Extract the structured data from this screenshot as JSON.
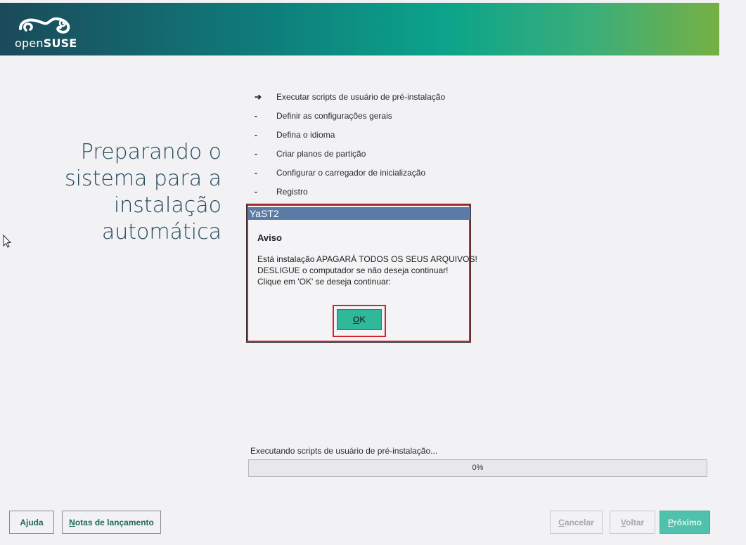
{
  "header": {
    "logo_light": "open",
    "logo_bold": "SUSE"
  },
  "page": {
    "title_lines": [
      "Preparando o",
      "sistema para a",
      "instalação",
      "automática"
    ]
  },
  "steps": [
    {
      "mark": "➔",
      "label": "Executar scripts de usuário de pré-instalação"
    },
    {
      "mark": "-",
      "label": "Definir as configurações gerais"
    },
    {
      "mark": "-",
      "label": "Defina o idioma"
    },
    {
      "mark": "-",
      "label": "Criar planos de partição"
    },
    {
      "mark": "-",
      "label": "Configurar o carregador de inicialização"
    },
    {
      "mark": "-",
      "label": "Registro"
    }
  ],
  "dialog": {
    "title": "YaST2",
    "heading": "Aviso",
    "message_lines": [
      "Está instalação APAGARÁ TODOS OS SEUS ARQUIVOS!",
      "DESLIGUE o computador se não deseja continuar!",
      "Clique em 'OK' se deseja continuar:"
    ],
    "ok_accel": "O",
    "ok_rest": "K"
  },
  "progress": {
    "label": "Executando scripts de usuário de pré-instalação...",
    "percent_text": "0%",
    "value": 0
  },
  "buttons": {
    "help": "Ajuda",
    "notes_accel": "N",
    "notes_rest": "otas de lançamento",
    "cancel_accel": "C",
    "cancel_rest": "ancelar",
    "back_accel": "V",
    "back_rest": "oltar",
    "next_accel": "P",
    "next_rest": "róximo"
  },
  "colors": {
    "accent": "#30b89a",
    "highlight": "#d8202c",
    "dialog_title_bg": "#5b7aa6"
  }
}
